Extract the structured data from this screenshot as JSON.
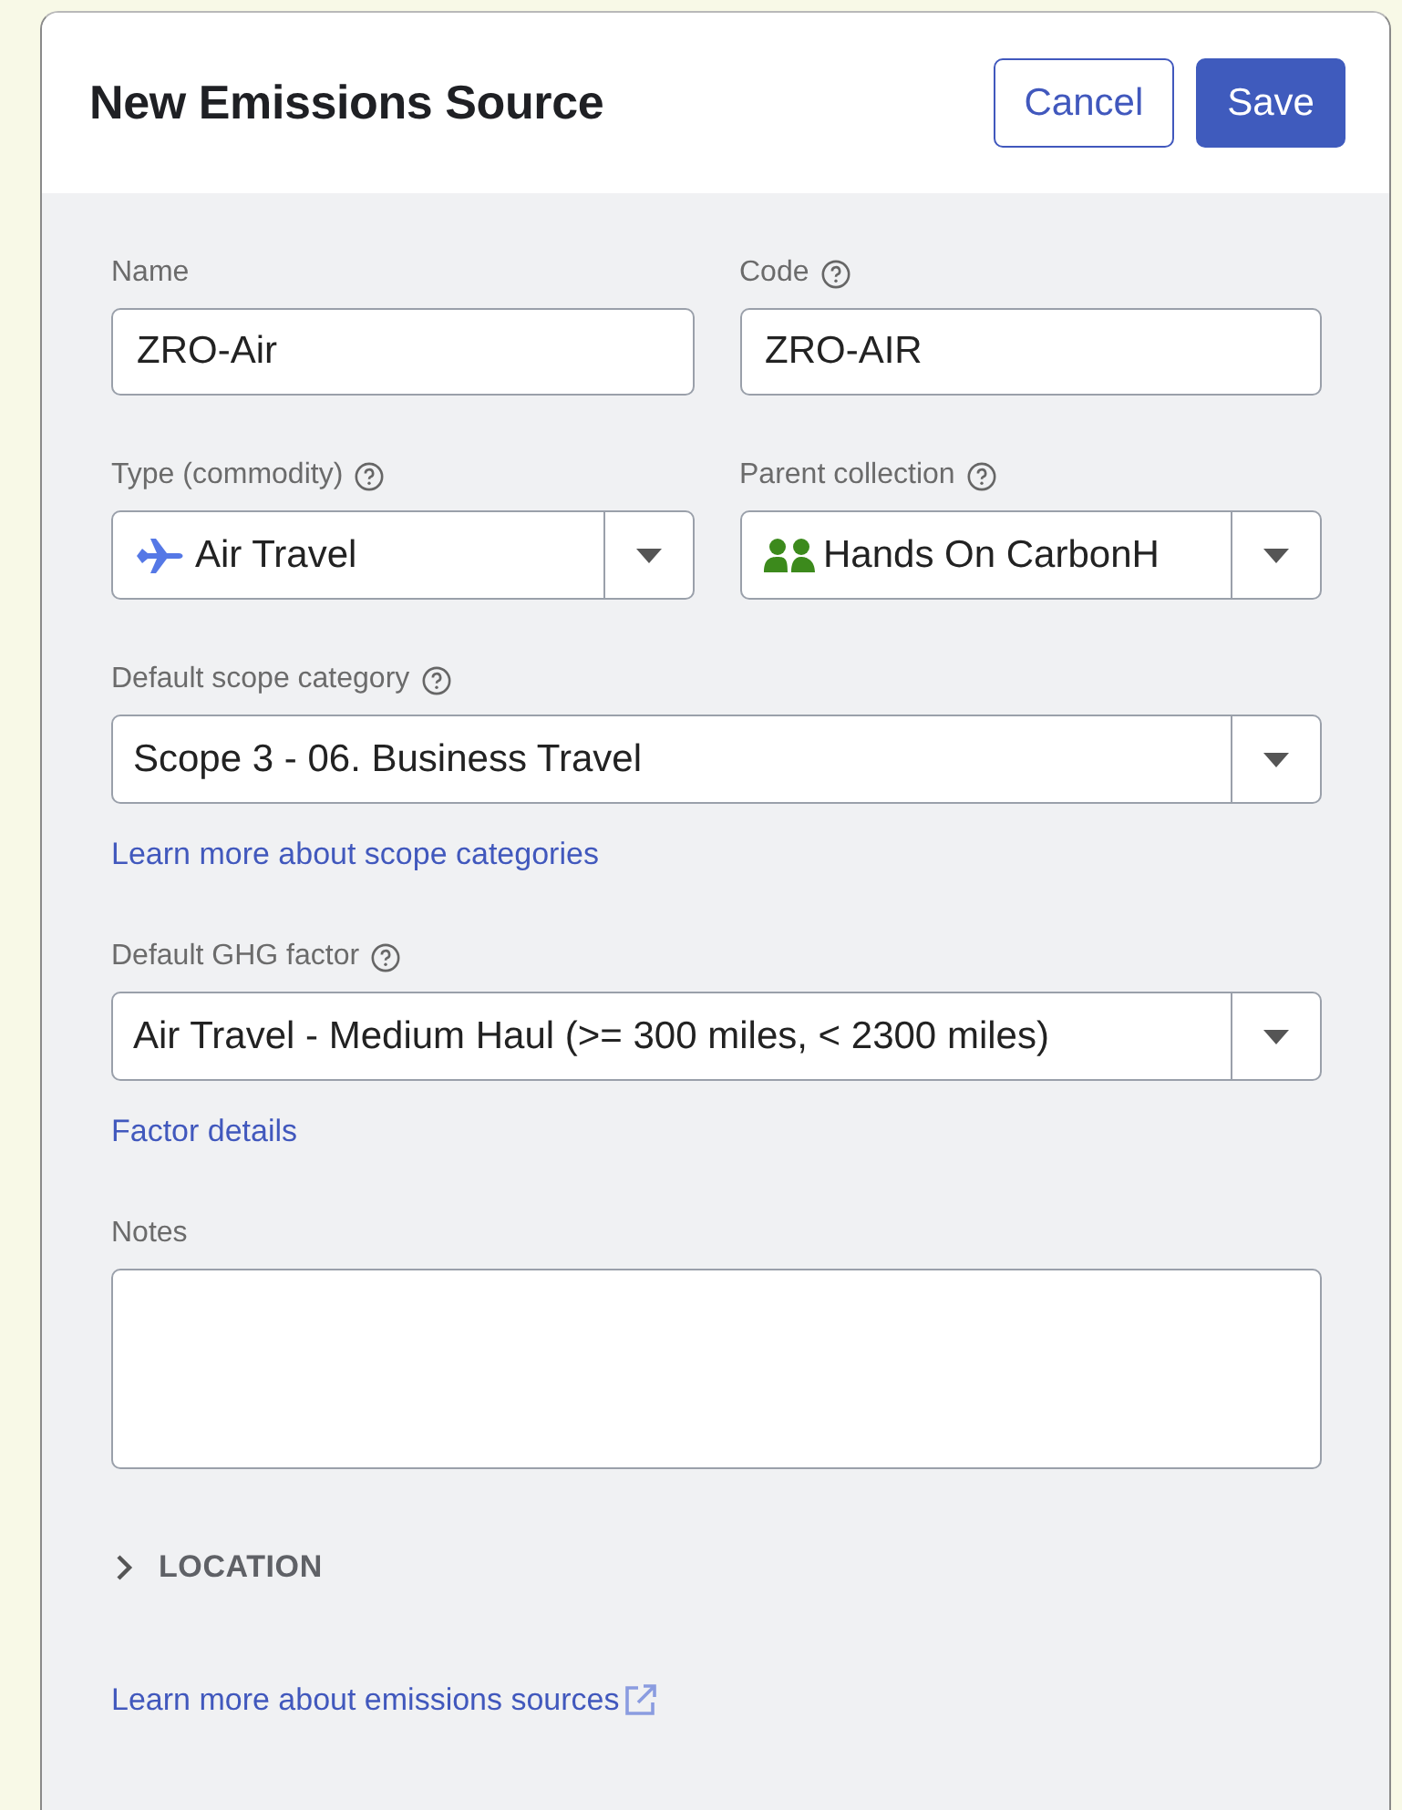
{
  "dialog": {
    "title": "New Emissions Source",
    "buttons": [
      {
        "label": "Cancel",
        "kind": "secondary"
      },
      {
        "label": "Save",
        "kind": "primary"
      }
    ]
  },
  "rows": [
    {
      "kind": "pair",
      "fields": [
        {
          "kind": "text",
          "label": "Name",
          "help": false,
          "value": "ZRO-Air"
        },
        {
          "kind": "text",
          "label": "Code",
          "help": true,
          "value": "ZRO-AIR"
        }
      ]
    },
    {
      "kind": "pair",
      "fields": [
        {
          "kind": "commodity",
          "label": "Type (commodity)",
          "help": true,
          "value": "Air Travel"
        },
        {
          "kind": "collection",
          "label": "Parent collection",
          "help": true,
          "value": "Hands On CarbonH"
        }
      ]
    },
    {
      "kind": "single",
      "fields": [
        {
          "kind": "select",
          "label": "Default scope category",
          "help": true,
          "value": "Scope 3 - 06. Business Travel"
        }
      ]
    },
    {
      "kind": "link",
      "text": "Learn more about scope categories",
      "external": false
    },
    {
      "kind": "single",
      "fields": [
        {
          "kind": "select",
          "label": "Default GHG factor",
          "help": true,
          "value": "Air Travel - Medium Haul (>= 300 miles, < 2300 miles)"
        }
      ]
    },
    {
      "kind": "link",
      "text": "Factor details",
      "external": false
    },
    {
      "kind": "single",
      "fields": [
        {
          "kind": "textarea",
          "label": "Notes",
          "help": false
        }
      ]
    },
    {
      "kind": "expander",
      "text": "LOCATION",
      "expanded": false
    },
    {
      "kind": "link",
      "text": "Learn more about emissions sources",
      "external": true
    }
  ]
}
